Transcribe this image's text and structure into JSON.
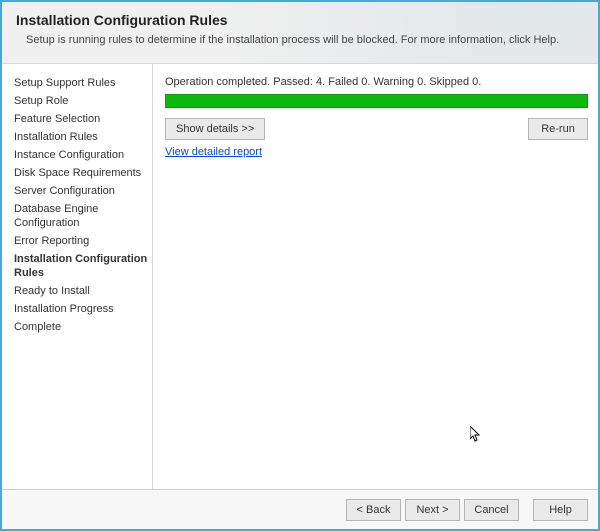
{
  "header": {
    "title": "Installation Configuration Rules",
    "subtitle": "Setup is running rules to determine if the installation process will be blocked. For more information, click Help."
  },
  "sidebar": {
    "items": [
      {
        "label": "Setup Support Rules",
        "current": false
      },
      {
        "label": "Setup Role",
        "current": false
      },
      {
        "label": "Feature Selection",
        "current": false
      },
      {
        "label": "Installation Rules",
        "current": false
      },
      {
        "label": "Instance Configuration",
        "current": false
      },
      {
        "label": "Disk Space Requirements",
        "current": false
      },
      {
        "label": "Server Configuration",
        "current": false
      },
      {
        "label": "Database Engine Configuration",
        "current": false
      },
      {
        "label": "Error Reporting",
        "current": false
      },
      {
        "label": "Installation Configuration Rules",
        "current": true
      },
      {
        "label": "Ready to Install",
        "current": false
      },
      {
        "label": "Installation Progress",
        "current": false
      },
      {
        "label": "Complete",
        "current": false
      }
    ]
  },
  "main": {
    "status": "Operation completed. Passed: 4.   Failed 0.   Warning 0.   Skipped 0.",
    "show_details_label": "Show details >>",
    "rerun_label": "Re-run",
    "view_report_label": "View detailed report"
  },
  "footer": {
    "back_label": "< Back",
    "next_label": "Next >",
    "cancel_label": "Cancel",
    "help_label": "Help"
  }
}
